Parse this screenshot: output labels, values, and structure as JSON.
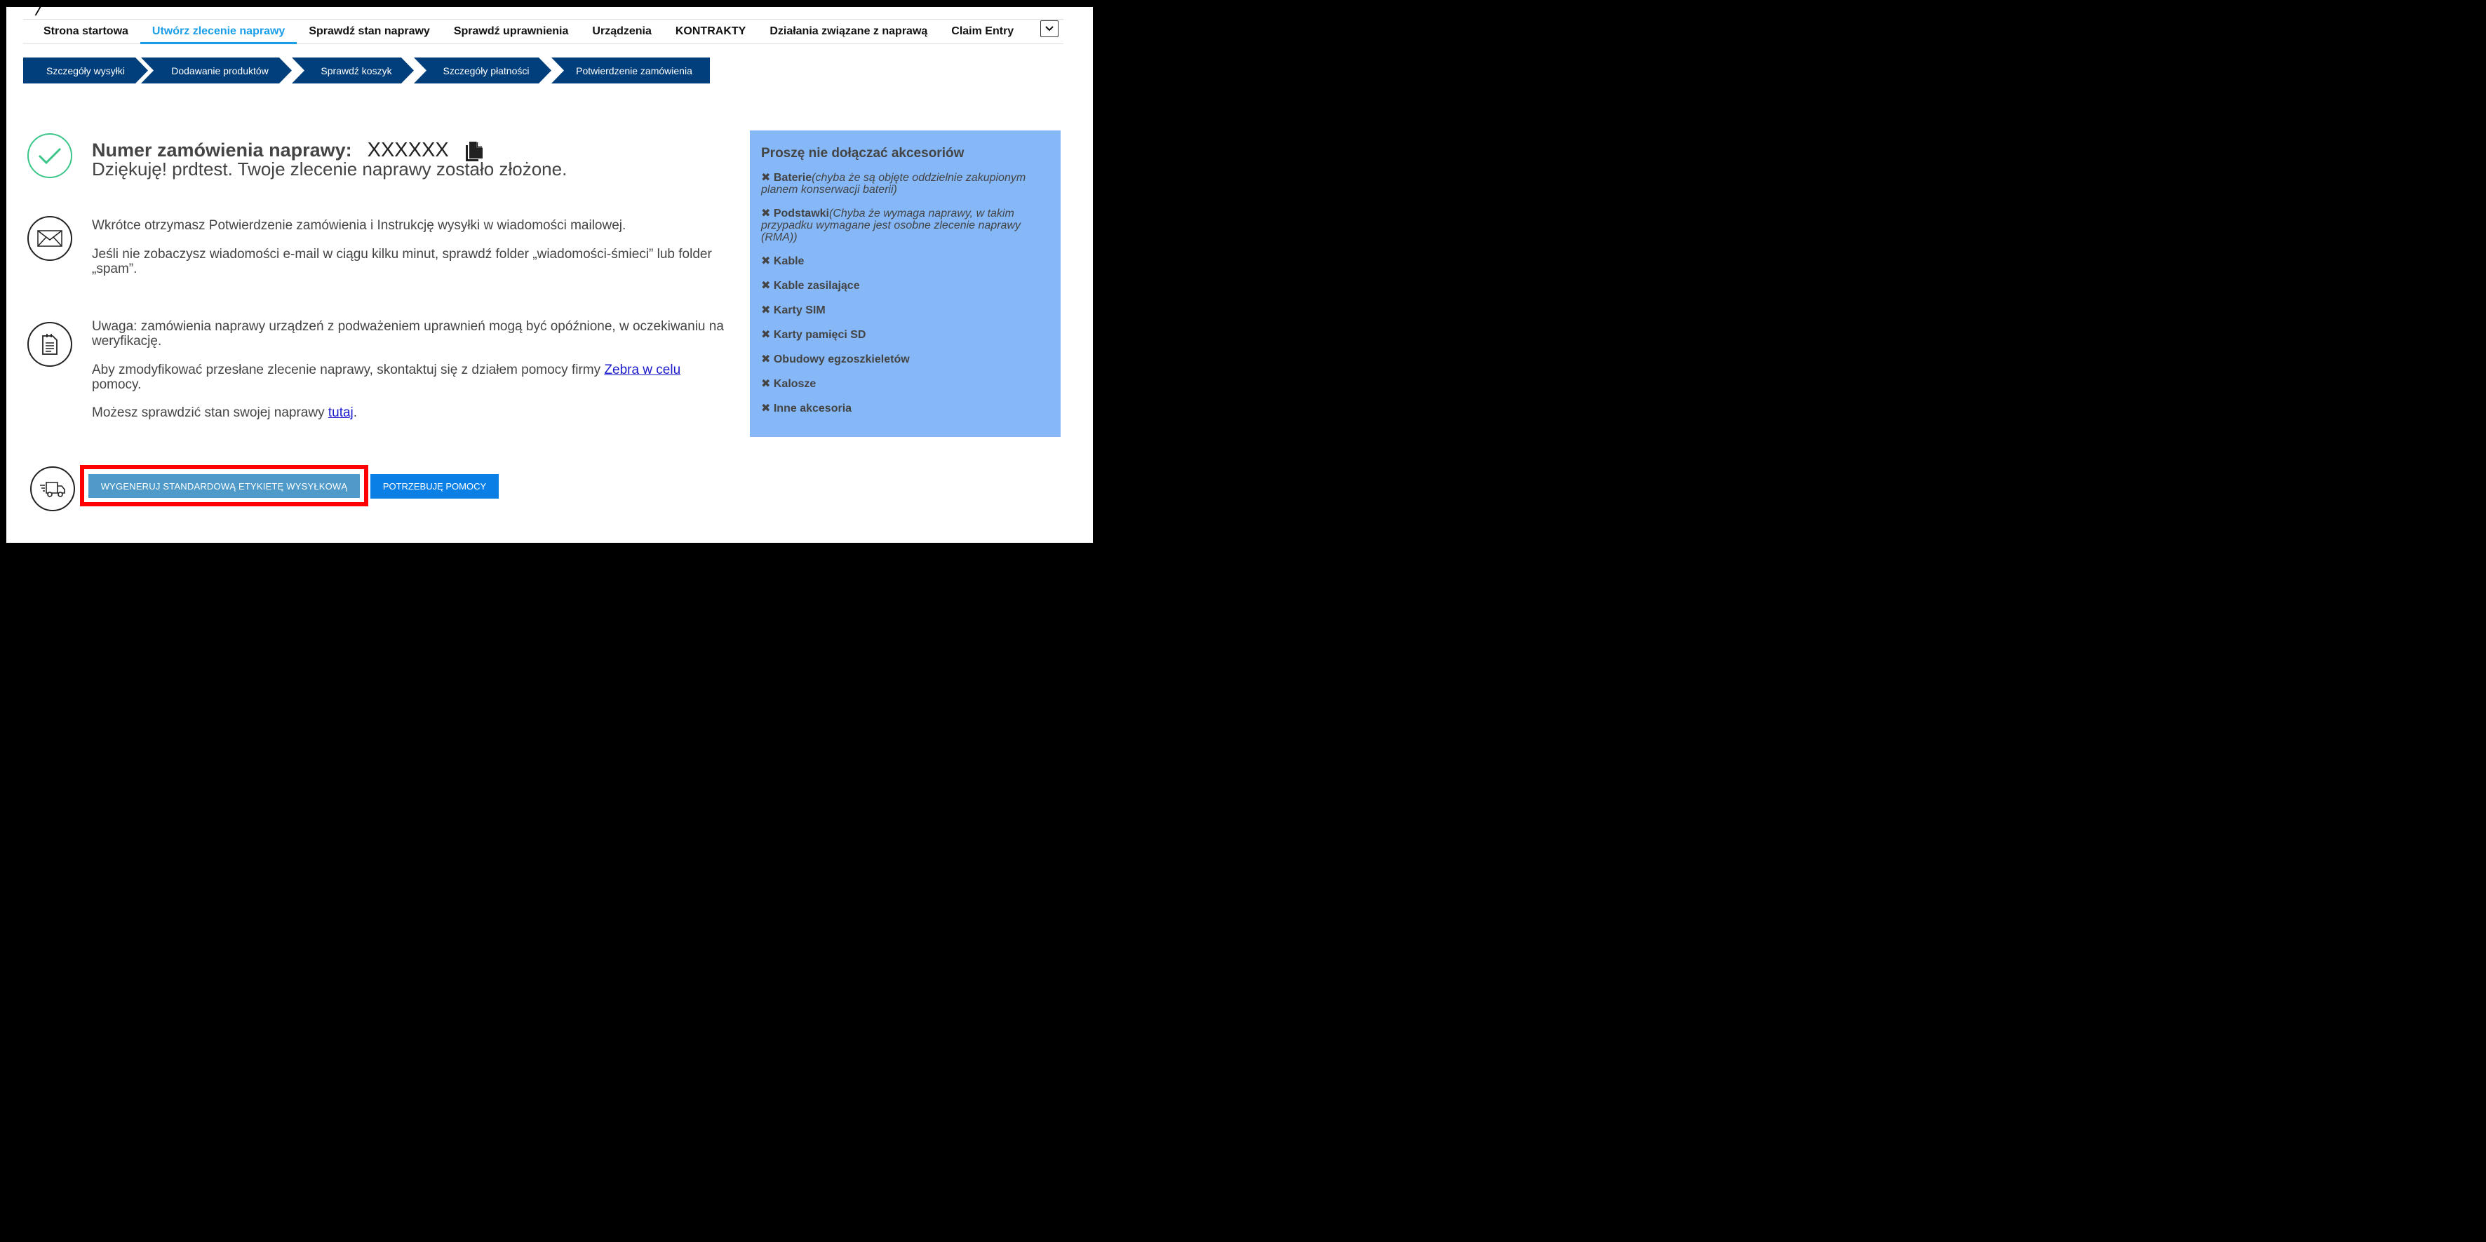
{
  "nav": {
    "items": [
      {
        "label": "Strona startowa",
        "active": false
      },
      {
        "label": "Utwórz zlecenie naprawy",
        "active": true
      },
      {
        "label": "Sprawdź stan naprawy",
        "active": false
      },
      {
        "label": "Sprawdź uprawnienia",
        "active": false
      },
      {
        "label": "Urządzenia",
        "active": false
      },
      {
        "label": "KONTRAKTY",
        "active": false
      },
      {
        "label": "Działania związane z naprawą",
        "active": false
      },
      {
        "label": "Claim Entry",
        "active": false
      }
    ]
  },
  "steps": [
    {
      "label": "Szczegóły wysyłki"
    },
    {
      "label": "Dodawanie produktów"
    },
    {
      "label": "Sprawdź koszyk"
    },
    {
      "label": "Szczegóły płatności"
    },
    {
      "label": "Potwierdzenie zamówienia"
    }
  ],
  "confirmation": {
    "order_label": "Numer zamówienia naprawy:",
    "order_number": "XXXXXX",
    "thanks": "Dziękuję! prdtest. Twoje zlecenie naprawy zostało złożone."
  },
  "email_info": {
    "line1": "Wkrótce otrzymasz Potwierdzenie zamówienia i Instrukcję wysyłki w wiadomości mailowej.",
    "line2": "Jeśli nie zobaczysz wiadomości e-mail w ciągu kilku minut, sprawdź folder „wiadomości-śmieci” lub folder „spam”."
  },
  "notes": {
    "warning": "Uwaga: zamówienia naprawy urządzeń z podważeniem uprawnień mogą być opóźnione, w oczekiwaniu na weryfikację.",
    "modify_prefix": "Aby zmodyfikować przesłane zlecenie naprawy, skontaktuj się z działem pomocy firmy ",
    "modify_link": " Zebra w celu",
    "modify_suffix": " pomocy.",
    "status_prefix": "Możesz sprawdzić stan swojej naprawy ",
    "status_link": "tutaj",
    "status_suffix": "."
  },
  "buttons": {
    "generate_label": "WYGENERUJ STANDARDOWĄ ETYKIETĘ WYSYŁKOWĄ",
    "help_label": "POTRZEBUJĘ POMOCY"
  },
  "accessories": {
    "title": "Proszę nie dołączać akcesoriów",
    "x_glyph": "✖",
    "items": [
      {
        "name": "Baterie",
        "note": "(chyba że są objęte oddzielnie zakupionym planem konserwacji baterii)"
      },
      {
        "name": "Podstawki",
        "note": "(Chyba że wymaga naprawy, w takim przypadku wymagane jest osobne zlecenie naprawy (RMA))"
      },
      {
        "name": "Kable",
        "note": ""
      },
      {
        "name": "Kable zasilające",
        "note": ""
      },
      {
        "name": "Karty SIM",
        "note": ""
      },
      {
        "name": "Karty pamięci SD",
        "note": ""
      },
      {
        "name": "Obudowy egzoszkieletów",
        "note": ""
      },
      {
        "name": "Kalosze",
        "note": ""
      },
      {
        "name": "Inne akcesoria",
        "note": ""
      }
    ]
  },
  "colors": {
    "nav_active": "#1a9ee8",
    "step_bg": "#003f7b",
    "check_green": "#3cc68a",
    "panel_bg": "#86b8f8",
    "generate_btn": "#4f9ac9",
    "help_btn": "#0a80e6",
    "highlight": "#ff0000"
  }
}
